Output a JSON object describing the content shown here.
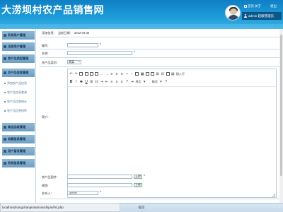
{
  "header": {
    "title": "大涝坝村农产品销售网",
    "links": [
      "首页",
      "关于",
      "退出"
    ],
    "user": "admin 超级管理员"
  },
  "sidebar": {
    "menus": [
      {
        "label": "系统用户管理"
      },
      {
        "label": "注册用户管理"
      },
      {
        "label": "类产品类型管理"
      },
      {
        "label": "农产品信息管理"
      },
      {
        "label": "商品品级管理"
      },
      {
        "label": "收藏信息管理"
      },
      {
        "label": "用户留言管理"
      },
      {
        "label": "系统信息管理"
      }
    ],
    "subs": [
      {
        "label": "添加农产品信息"
      },
      {
        "label": "农产品信息查询"
      },
      {
        "label": "农产品信息统计"
      },
      {
        "label": "农产品信息排序"
      }
    ]
  },
  "content": {
    "crumb": {
      "mgr": "添加信息:",
      "sep": "当前日期:",
      "date": "2022-03-30"
    },
    "fields": {
      "number": {
        "label": "编号:",
        "value": ""
      },
      "name": {
        "label": "名称:",
        "value": ""
      },
      "category": {
        "label": "农产品类别:",
        "selected": "蔬菜"
      },
      "intro": {
        "label": "简介:"
      },
      "image": {
        "label": "农产品图片:",
        "value": "",
        "button": "上传"
      },
      "video": {
        "label": "视频:",
        "value": "",
        "button": "上传"
      },
      "publisher": {
        "label": "发布人:",
        "value": "admin"
      }
    },
    "editor": {
      "toolbar1": [
        "源码",
        "打印",
        "预览",
        "模板",
        "剪切",
        "复制",
        "粘贴",
        "撤销",
        "重做",
        "居左",
        "代码",
        "对齐",
        "图片",
        "表格",
        "链接",
        "全屏",
        "插入",
        "图片2",
        "插入2",
        "删除线"
      ],
      "toolbar2_font_style": "样式",
      "toolbar2_format": "格式",
      "toolbar2_help": "?"
    }
  },
  "status": {
    "url": "localhost/nongchanpin/admin/shipin/list.php"
  },
  "footer": {
    "submit": "提交"
  },
  "colors": {
    "header": "#1c9ad8",
    "menu": "#7aa8cc",
    "border": "#c7dced"
  }
}
